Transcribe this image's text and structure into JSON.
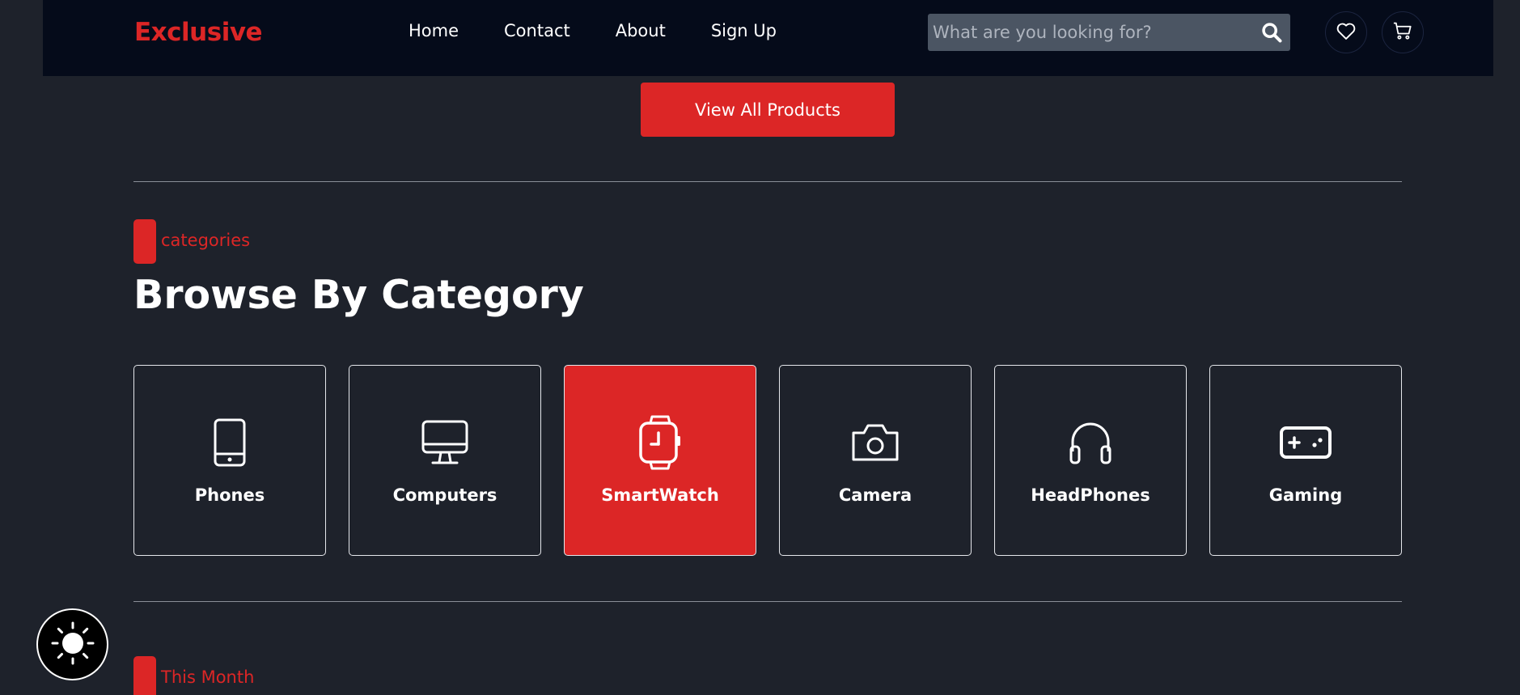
{
  "nav": {
    "logo": "Exclusive",
    "links": [
      "Home",
      "Contact",
      "About",
      "Sign Up"
    ],
    "search_placeholder": "What are you looking for?",
    "icons": [
      "search-icon",
      "heart-icon",
      "cart-icon"
    ]
  },
  "view_all_button": "View All Products",
  "categories_section": {
    "tag": "categories",
    "title": "Browse By Category",
    "items": [
      {
        "label": "Phones",
        "icon": "phone-icon",
        "active": false
      },
      {
        "label": "Computers",
        "icon": "computer-icon",
        "active": false
      },
      {
        "label": "SmartWatch",
        "icon": "smartwatch-icon",
        "active": true
      },
      {
        "label": "Camera",
        "icon": "camera-icon",
        "active": false
      },
      {
        "label": "HeadPhones",
        "icon": "headphones-icon",
        "active": false
      },
      {
        "label": "Gaming",
        "icon": "gamepad-icon",
        "active": false
      }
    ]
  },
  "next_section": {
    "tag": "This Month"
  },
  "colors": {
    "accent": "#dc2626",
    "background": "#1e222b",
    "navbar": "#050b1a",
    "search_bg": "#4b5563"
  },
  "theme_toggle_icon": "sun-icon"
}
